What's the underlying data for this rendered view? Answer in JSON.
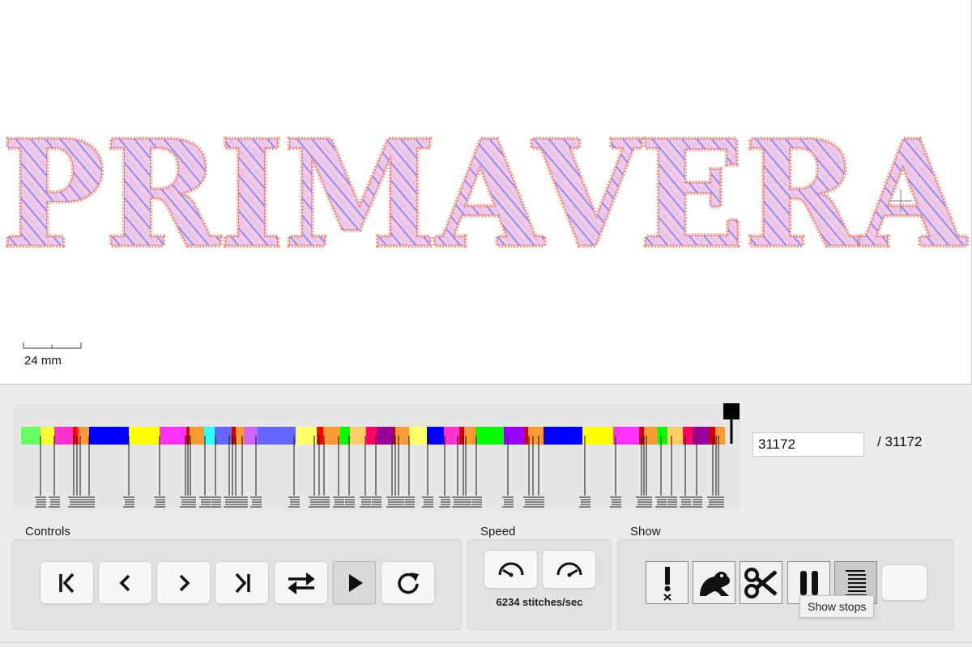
{
  "design": {
    "text": "PRIMAVERA",
    "scale_label": "24 mm"
  },
  "timeline": {
    "color_blocks": [
      {
        "color": "#66ff66",
        "w": 24
      },
      {
        "color": "#ffff33",
        "w": 17
      },
      {
        "color": "#ff33cc",
        "w": 23
      },
      {
        "color": "#ff0000",
        "w": 5
      },
      {
        "color": "#ff3333",
        "w": 2
      },
      {
        "color": "#ff9933",
        "w": 13
      },
      {
        "color": "#0000ff",
        "w": 49
      },
      {
        "color": "#ffff00",
        "w": 38
      },
      {
        "color": "#ff33ff",
        "w": 33
      },
      {
        "color": "#cc0000",
        "w": 4
      },
      {
        "color": "#ff9933",
        "w": 18
      },
      {
        "color": "#33ffff",
        "w": 13
      },
      {
        "color": "#6666ff",
        "w": 21
      },
      {
        "color": "#cc0000",
        "w": 5
      },
      {
        "color": "#ff9933",
        "w": 10
      },
      {
        "color": "#cc66ff",
        "w": 17
      },
      {
        "color": "#6666ff",
        "w": 47
      },
      {
        "color": "#ffff66",
        "w": 26
      },
      {
        "color": "#ff0000",
        "w": 8
      },
      {
        "color": "#ff9933",
        "w": 21
      },
      {
        "color": "#00ff00",
        "w": 12
      },
      {
        "color": "#ffcc66",
        "w": 20
      },
      {
        "color": "#ff0066",
        "w": 13
      },
      {
        "color": "#990099",
        "w": 20
      },
      {
        "color": "#cc0000",
        "w": 3
      },
      {
        "color": "#ff9933",
        "w": 17
      },
      {
        "color": "#ffff66",
        "w": 22
      },
      {
        "color": "#0000ff",
        "w": 21
      },
      {
        "color": "#ff33cc",
        "w": 19
      },
      {
        "color": "#cc0000",
        "w": 6
      },
      {
        "color": "#ff9933",
        "w": 14
      },
      {
        "color": "#00ff00",
        "w": 35
      },
      {
        "color": "#9900ff",
        "w": 26
      },
      {
        "color": "#cc0000",
        "w": 4
      },
      {
        "color": "#ff9933",
        "w": 19
      },
      {
        "color": "#0000ff",
        "w": 48
      },
      {
        "color": "#ffff00",
        "w": 38
      },
      {
        "color": "#ff33ff",
        "w": 32
      },
      {
        "color": "#cc0000",
        "w": 6
      },
      {
        "color": "#ff9933",
        "w": 17
      },
      {
        "color": "#00ff00",
        "w": 12
      },
      {
        "color": "#ffcc66",
        "w": 19
      },
      {
        "color": "#ff0066",
        "w": 12
      },
      {
        "color": "#990099",
        "w": 21
      },
      {
        "color": "#cc0000",
        "w": 7
      },
      {
        "color": "#ff9933",
        "w": 12
      }
    ],
    "stop_positions": [
      50,
      67,
      91,
      95,
      99,
      110,
      159,
      197,
      229,
      232,
      235,
      253,
      266,
      283,
      287,
      291,
      299,
      316,
      363,
      388,
      394,
      400,
      418,
      431,
      451,
      464,
      484,
      488,
      492,
      505,
      528,
      549,
      565,
      572,
      575,
      588,
      627,
      653,
      658,
      665,
      722,
      760,
      792,
      795,
      798,
      816,
      829,
      846,
      860,
      880,
      884,
      887
    ]
  },
  "stitch": {
    "current": "31172",
    "total_label": "/ 31172"
  },
  "controls": {
    "label": "Controls",
    "buttons": [
      {
        "name": "skip-to-start-button",
        "icon": "skip-start-icon"
      },
      {
        "name": "step-backward-button",
        "icon": "chevron-left-icon"
      },
      {
        "name": "step-forward-button",
        "icon": "chevron-right-icon"
      },
      {
        "name": "skip-to-end-button",
        "icon": "skip-end-icon"
      },
      {
        "name": "toggle-direction-button",
        "icon": "swap-arrows-icon"
      },
      {
        "name": "play-button",
        "icon": "play-icon",
        "active": true
      },
      {
        "name": "restart-button",
        "icon": "refresh-icon"
      }
    ]
  },
  "speed": {
    "label": "Speed",
    "rate_text": "6234 stitches/sec",
    "buttons": [
      {
        "name": "slower-button",
        "icon": "speed-down-icon"
      },
      {
        "name": "faster-button",
        "icon": "speed-up-icon"
      }
    ]
  },
  "show": {
    "label": "Show",
    "tooltip": "Show stops",
    "toggles": [
      {
        "name": "show-errors-toggle",
        "icon": "warning-exclamation-icon"
      },
      {
        "name": "show-jumps-toggle",
        "icon": "frog-icon"
      },
      {
        "name": "show-trims-toggle",
        "icon": "scissors-icon"
      },
      {
        "name": "show-pauses-toggle",
        "icon": "pause-icon"
      },
      {
        "name": "show-stops-toggle",
        "icon": "stop-lines-icon",
        "active": true
      }
    ]
  }
}
